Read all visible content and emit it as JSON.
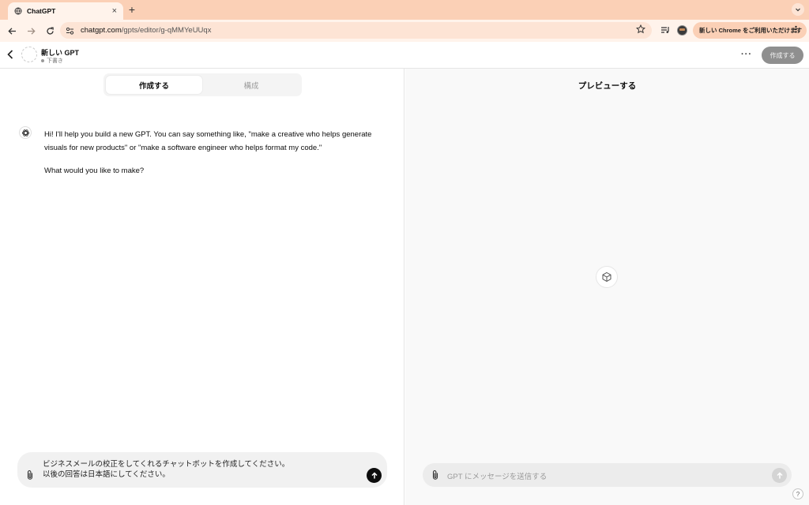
{
  "browser": {
    "tab_title": "ChatGPT",
    "tab_close": "×",
    "new_tab": "+",
    "url_host": "chatgpt.com",
    "url_path": "/gpts/editor/g-qMMYeUUqx",
    "update_text": "新しい Chrome をご利用いただけます",
    "update_menu": "⋮"
  },
  "header": {
    "gpt_name": "新しい GPT",
    "status": "下書き",
    "more": "···",
    "create_button": "作成する"
  },
  "editor": {
    "tab_create": "作成する",
    "tab_configure": "構成",
    "message_line1": "Hi! I'll help you build a new GPT. You can say something like, \"make a creative who helps generate visuals for new products\" or \"make a software engineer who helps format my code.\"",
    "message_line2": "What would you like to make?",
    "composer_line1": "ビジネスメールの校正をしてくれるチャットボットを作成してください。",
    "composer_line2": "以後の回答は日本語にしてください。"
  },
  "preview": {
    "title": "プレビューする",
    "placeholder": "GPT にメッセージを送信する",
    "help": "?"
  },
  "colors": {
    "tabstrip": "#fbd0b6",
    "toolbar": "#fff3eb",
    "omnibox": "#fde4d5",
    "create_button": "#8f8f8f",
    "send_active": "#0d0d0d",
    "send_disabled": "#d4d4d4"
  },
  "icons": [
    "globe-icon",
    "back-arrow-icon",
    "forward-arrow-icon",
    "reload-icon",
    "site-info-icon",
    "star-icon",
    "media-controls-icon",
    "chevron-left-icon",
    "openai-logo-icon",
    "paperclip-icon",
    "arrow-up-icon",
    "cube-icon",
    "help-icon"
  ]
}
